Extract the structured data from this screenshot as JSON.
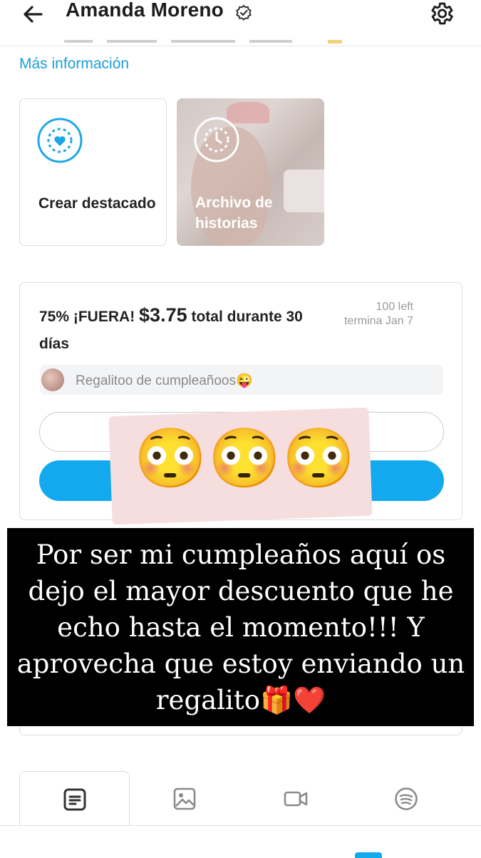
{
  "header": {
    "title": "Amanda Moreno",
    "back_icon": "arrow-left-icon",
    "verified_icon": "verified-badge-icon",
    "settings_icon": "gear-icon"
  },
  "profile": {
    "more_info_link": "Más información"
  },
  "highlights": [
    {
      "label": "Crear destacado",
      "icon": "highlight-heart-icon"
    },
    {
      "label": "Archivo de historias",
      "icon": "clock-icon"
    }
  ],
  "promo": {
    "discount": "75% ¡FUERA!",
    "price": "$3.75",
    "price_suffix": "total durante 30 días",
    "left": "100 left",
    "ends": "termina Jan 7",
    "gift_message": "Regalitoo de cumpleañoos😜"
  },
  "sticker": {
    "emojis": "😳😳😳"
  },
  "story": {
    "text": "Por ser mi cumpleaños aquí os dejo el mayor descuento que he echo hasta el momento!!! Y aprovecha que estoy enviando un regalito🎁❤️"
  },
  "tabs": [
    {
      "name": "posts",
      "icon": "post-icon",
      "active": true
    },
    {
      "name": "photos",
      "icon": "image-icon",
      "active": false
    },
    {
      "name": "videos",
      "icon": "video-icon",
      "active": false
    },
    {
      "name": "audio",
      "icon": "spotify-icon",
      "active": false
    }
  ],
  "colors": {
    "accent": "#13a9ef",
    "link": "#1a9fd8",
    "story_background": "#000000",
    "sticker_background": "#f6dede"
  }
}
